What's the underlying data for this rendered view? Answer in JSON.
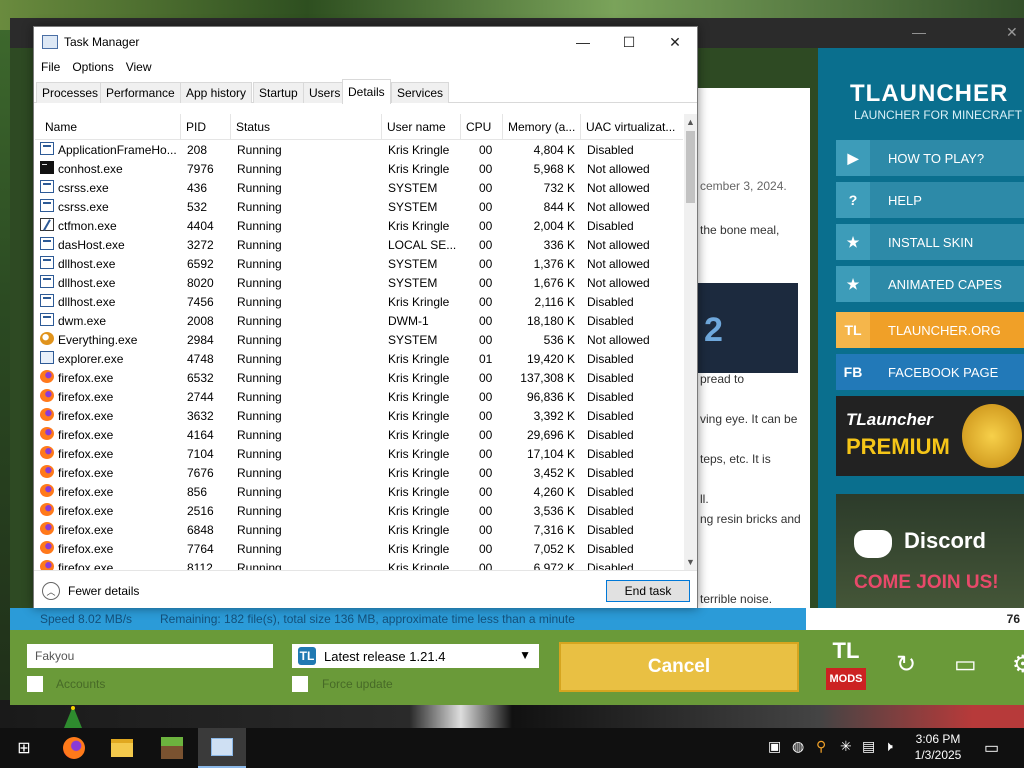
{
  "task_manager": {
    "title": "Task Manager",
    "window_controls": {
      "minimize": "—",
      "maximize": "☐",
      "close": "✕"
    },
    "menu": [
      "File",
      "Options",
      "View"
    ],
    "tabs": [
      "Processes",
      "Performance",
      "App history",
      "Startup",
      "Users",
      "Details",
      "Services"
    ],
    "active_tab": "Details",
    "columns": [
      "Name",
      "PID",
      "Status",
      "User name",
      "CPU",
      "Memory (a...",
      "UAC virtualizat..."
    ],
    "rows": [
      {
        "name": "ApplicationFrameHo...",
        "pid": "208",
        "status": "Running",
        "user": "Kris Kringle",
        "cpu": "00",
        "mem": "4,804 K",
        "uac": "Disabled",
        "icon": "app-icon"
      },
      {
        "name": "conhost.exe",
        "pid": "7976",
        "status": "Running",
        "user": "Kris Kringle",
        "cpu": "00",
        "mem": "5,968 K",
        "uac": "Not allowed",
        "icon": "console-icon"
      },
      {
        "name": "csrss.exe",
        "pid": "436",
        "status": "Running",
        "user": "SYSTEM",
        "cpu": "00",
        "mem": "732 K",
        "uac": "Not allowed",
        "icon": "app-icon"
      },
      {
        "name": "csrss.exe",
        "pid": "532",
        "status": "Running",
        "user": "SYSTEM",
        "cpu": "00",
        "mem": "844 K",
        "uac": "Not allowed",
        "icon": "app-icon"
      },
      {
        "name": "ctfmon.exe",
        "pid": "4404",
        "status": "Running",
        "user": "Kris Kringle",
        "cpu": "00",
        "mem": "2,004 K",
        "uac": "Disabled",
        "icon": "ctfmon-icon"
      },
      {
        "name": "dasHost.exe",
        "pid": "3272",
        "status": "Running",
        "user": "LOCAL SE...",
        "cpu": "00",
        "mem": "336 K",
        "uac": "Not allowed",
        "icon": "app-icon"
      },
      {
        "name": "dllhost.exe",
        "pid": "6592",
        "status": "Running",
        "user": "SYSTEM",
        "cpu": "00",
        "mem": "1,376 K",
        "uac": "Not allowed",
        "icon": "app-icon"
      },
      {
        "name": "dllhost.exe",
        "pid": "8020",
        "status": "Running",
        "user": "SYSTEM",
        "cpu": "00",
        "mem": "1,676 K",
        "uac": "Not allowed",
        "icon": "app-icon"
      },
      {
        "name": "dllhost.exe",
        "pid": "7456",
        "status": "Running",
        "user": "Kris Kringle",
        "cpu": "00",
        "mem": "2,116 K",
        "uac": "Disabled",
        "icon": "app-icon"
      },
      {
        "name": "dwm.exe",
        "pid": "2008",
        "status": "Running",
        "user": "DWM-1",
        "cpu": "00",
        "mem": "18,180 K",
        "uac": "Disabled",
        "icon": "app-icon"
      },
      {
        "name": "Everything.exe",
        "pid": "2984",
        "status": "Running",
        "user": "SYSTEM",
        "cpu": "00",
        "mem": "536 K",
        "uac": "Not allowed",
        "icon": "everything-icon"
      },
      {
        "name": "explorer.exe",
        "pid": "4748",
        "status": "Running",
        "user": "Kris Kringle",
        "cpu": "01",
        "mem": "19,420 K",
        "uac": "Disabled",
        "icon": "explorer-icon"
      },
      {
        "name": "firefox.exe",
        "pid": "6532",
        "status": "Running",
        "user": "Kris Kringle",
        "cpu": "00",
        "mem": "137,308 K",
        "uac": "Disabled",
        "icon": "firefox-icon"
      },
      {
        "name": "firefox.exe",
        "pid": "2744",
        "status": "Running",
        "user": "Kris Kringle",
        "cpu": "00",
        "mem": "96,836 K",
        "uac": "Disabled",
        "icon": "firefox-icon"
      },
      {
        "name": "firefox.exe",
        "pid": "3632",
        "status": "Running",
        "user": "Kris Kringle",
        "cpu": "00",
        "mem": "3,392 K",
        "uac": "Disabled",
        "icon": "firefox-icon"
      },
      {
        "name": "firefox.exe",
        "pid": "4164",
        "status": "Running",
        "user": "Kris Kringle",
        "cpu": "00",
        "mem": "29,696 K",
        "uac": "Disabled",
        "icon": "firefox-icon"
      },
      {
        "name": "firefox.exe",
        "pid": "7104",
        "status": "Running",
        "user": "Kris Kringle",
        "cpu": "00",
        "mem": "17,104 K",
        "uac": "Disabled",
        "icon": "firefox-icon"
      },
      {
        "name": "firefox.exe",
        "pid": "7676",
        "status": "Running",
        "user": "Kris Kringle",
        "cpu": "00",
        "mem": "3,452 K",
        "uac": "Disabled",
        "icon": "firefox-icon"
      },
      {
        "name": "firefox.exe",
        "pid": "856",
        "status": "Running",
        "user": "Kris Kringle",
        "cpu": "00",
        "mem": "4,260 K",
        "uac": "Disabled",
        "icon": "firefox-icon"
      },
      {
        "name": "firefox.exe",
        "pid": "2516",
        "status": "Running",
        "user": "Kris Kringle",
        "cpu": "00",
        "mem": "3,536 K",
        "uac": "Disabled",
        "icon": "firefox-icon"
      },
      {
        "name": "firefox.exe",
        "pid": "6848",
        "status": "Running",
        "user": "Kris Kringle",
        "cpu": "00",
        "mem": "7,316 K",
        "uac": "Disabled",
        "icon": "firefox-icon"
      },
      {
        "name": "firefox.exe",
        "pid": "7764",
        "status": "Running",
        "user": "Kris Kringle",
        "cpu": "00",
        "mem": "7,052 K",
        "uac": "Disabled",
        "icon": "firefox-icon"
      },
      {
        "name": "firefox.exe",
        "pid": "8112",
        "status": "Running",
        "user": "Kris Kringle",
        "cpu": "00",
        "mem": "6,972 K",
        "uac": "Disabled",
        "icon": "firefox-icon"
      }
    ],
    "fewer_details": "Fewer details",
    "end_task": "End task"
  },
  "tlauncher": {
    "logo_title": "TLAUNCHER",
    "logo_subtitle": "LAUNCHER FOR MINECRAFT",
    "menu": [
      {
        "icon": "▶",
        "label": "HOW TO PLAY?",
        "style": "blue"
      },
      {
        "icon": "?",
        "label": "HELP",
        "style": "blue"
      },
      {
        "icon": "★",
        "label": "INSTALL SKIN",
        "style": "blue"
      },
      {
        "icon": "★",
        "label": "ANIMATED CAPES",
        "style": "blue"
      },
      {
        "icon": "TL",
        "label": "TLAUNCHER.ORG",
        "style": "orange"
      },
      {
        "icon": "FB",
        "label": "FACEBOOK PAGE",
        "style": "fb"
      }
    ],
    "premium_line1": "TLauncher",
    "premium_line2": "PREMIUM",
    "discord_title": "Discord",
    "discord_subtitle": "COME JOIN US!",
    "content_fragments": [
      "cember 3, 2024.",
      "the bone meal,",
      "2",
      "pread to",
      "ving eye. It can be",
      "teps, etc. It is",
      "ll.",
      "ng resin bricks and",
      "terrible noise."
    ],
    "status_speed": "Speed 8.02 MB/s",
    "status_remaining": "Remaining: 182 file(s), total size 136 MB, approximate time less than a minute",
    "status_percent": "76",
    "nickname": "Fakyou",
    "accounts_label": "Accounts",
    "version_icon": "TL",
    "version": "Latest release 1.21.4",
    "force_update_label": "Force update",
    "cancel_label": "Cancel",
    "mods_logo": "TL",
    "mods_label": "MODS"
  },
  "taskbar": {
    "start_icon": "⊞",
    "apps": [
      "firefox-icon",
      "file-explorer-icon",
      "minecraft-icon",
      "task-manager-icon"
    ],
    "time": "3:06 PM",
    "date": "1/3/2025"
  },
  "colors": {
    "tl_sidebar": "#0a6f8e",
    "tl_bottom": "#6a9a39",
    "cancel": "#e9c043",
    "status_bar": "#2b9bd8"
  }
}
